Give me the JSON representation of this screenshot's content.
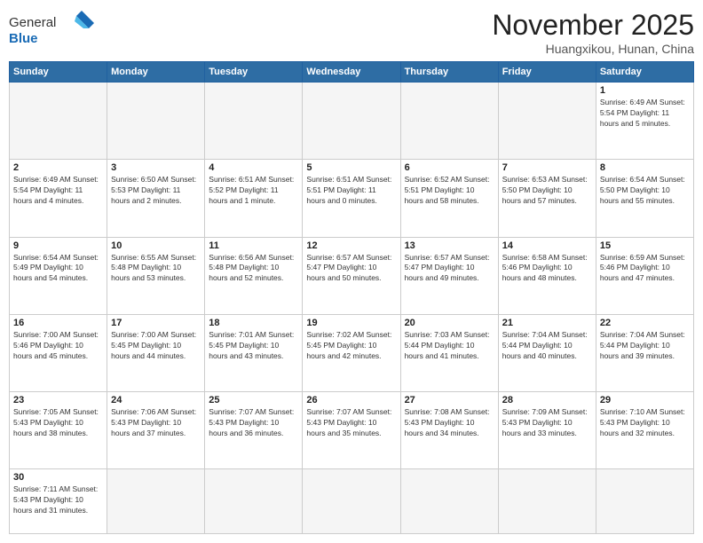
{
  "header": {
    "logo_general": "General",
    "logo_blue": "Blue",
    "month_title": "November 2025",
    "location": "Huangxikou, Hunan, China"
  },
  "days_of_week": [
    "Sunday",
    "Monday",
    "Tuesday",
    "Wednesday",
    "Thursday",
    "Friday",
    "Saturday"
  ],
  "weeks": [
    [
      {
        "day": "",
        "info": "",
        "empty": true
      },
      {
        "day": "",
        "info": "",
        "empty": true
      },
      {
        "day": "",
        "info": "",
        "empty": true
      },
      {
        "day": "",
        "info": "",
        "empty": true
      },
      {
        "day": "",
        "info": "",
        "empty": true
      },
      {
        "day": "",
        "info": "",
        "empty": true
      },
      {
        "day": "1",
        "info": "Sunrise: 6:49 AM\nSunset: 5:54 PM\nDaylight: 11 hours\nand 5 minutes."
      }
    ],
    [
      {
        "day": "2",
        "info": "Sunrise: 6:49 AM\nSunset: 5:54 PM\nDaylight: 11 hours\nand 4 minutes."
      },
      {
        "day": "3",
        "info": "Sunrise: 6:50 AM\nSunset: 5:53 PM\nDaylight: 11 hours\nand 2 minutes."
      },
      {
        "day": "4",
        "info": "Sunrise: 6:51 AM\nSunset: 5:52 PM\nDaylight: 11 hours\nand 1 minute."
      },
      {
        "day": "5",
        "info": "Sunrise: 6:51 AM\nSunset: 5:51 PM\nDaylight: 11 hours\nand 0 minutes."
      },
      {
        "day": "6",
        "info": "Sunrise: 6:52 AM\nSunset: 5:51 PM\nDaylight: 10 hours\nand 58 minutes."
      },
      {
        "day": "7",
        "info": "Sunrise: 6:53 AM\nSunset: 5:50 PM\nDaylight: 10 hours\nand 57 minutes."
      },
      {
        "day": "8",
        "info": "Sunrise: 6:54 AM\nSunset: 5:50 PM\nDaylight: 10 hours\nand 55 minutes."
      }
    ],
    [
      {
        "day": "9",
        "info": "Sunrise: 6:54 AM\nSunset: 5:49 PM\nDaylight: 10 hours\nand 54 minutes."
      },
      {
        "day": "10",
        "info": "Sunrise: 6:55 AM\nSunset: 5:48 PM\nDaylight: 10 hours\nand 53 minutes."
      },
      {
        "day": "11",
        "info": "Sunrise: 6:56 AM\nSunset: 5:48 PM\nDaylight: 10 hours\nand 52 minutes."
      },
      {
        "day": "12",
        "info": "Sunrise: 6:57 AM\nSunset: 5:47 PM\nDaylight: 10 hours\nand 50 minutes."
      },
      {
        "day": "13",
        "info": "Sunrise: 6:57 AM\nSunset: 5:47 PM\nDaylight: 10 hours\nand 49 minutes."
      },
      {
        "day": "14",
        "info": "Sunrise: 6:58 AM\nSunset: 5:46 PM\nDaylight: 10 hours\nand 48 minutes."
      },
      {
        "day": "15",
        "info": "Sunrise: 6:59 AM\nSunset: 5:46 PM\nDaylight: 10 hours\nand 47 minutes."
      }
    ],
    [
      {
        "day": "16",
        "info": "Sunrise: 7:00 AM\nSunset: 5:46 PM\nDaylight: 10 hours\nand 45 minutes."
      },
      {
        "day": "17",
        "info": "Sunrise: 7:00 AM\nSunset: 5:45 PM\nDaylight: 10 hours\nand 44 minutes."
      },
      {
        "day": "18",
        "info": "Sunrise: 7:01 AM\nSunset: 5:45 PM\nDaylight: 10 hours\nand 43 minutes."
      },
      {
        "day": "19",
        "info": "Sunrise: 7:02 AM\nSunset: 5:45 PM\nDaylight: 10 hours\nand 42 minutes."
      },
      {
        "day": "20",
        "info": "Sunrise: 7:03 AM\nSunset: 5:44 PM\nDaylight: 10 hours\nand 41 minutes."
      },
      {
        "day": "21",
        "info": "Sunrise: 7:04 AM\nSunset: 5:44 PM\nDaylight: 10 hours\nand 40 minutes."
      },
      {
        "day": "22",
        "info": "Sunrise: 7:04 AM\nSunset: 5:44 PM\nDaylight: 10 hours\nand 39 minutes."
      }
    ],
    [
      {
        "day": "23",
        "info": "Sunrise: 7:05 AM\nSunset: 5:43 PM\nDaylight: 10 hours\nand 38 minutes."
      },
      {
        "day": "24",
        "info": "Sunrise: 7:06 AM\nSunset: 5:43 PM\nDaylight: 10 hours\nand 37 minutes."
      },
      {
        "day": "25",
        "info": "Sunrise: 7:07 AM\nSunset: 5:43 PM\nDaylight: 10 hours\nand 36 minutes."
      },
      {
        "day": "26",
        "info": "Sunrise: 7:07 AM\nSunset: 5:43 PM\nDaylight: 10 hours\nand 35 minutes."
      },
      {
        "day": "27",
        "info": "Sunrise: 7:08 AM\nSunset: 5:43 PM\nDaylight: 10 hours\nand 34 minutes."
      },
      {
        "day": "28",
        "info": "Sunrise: 7:09 AM\nSunset: 5:43 PM\nDaylight: 10 hours\nand 33 minutes."
      },
      {
        "day": "29",
        "info": "Sunrise: 7:10 AM\nSunset: 5:43 PM\nDaylight: 10 hours\nand 32 minutes."
      }
    ],
    [
      {
        "day": "30",
        "info": "Sunrise: 7:11 AM\nSunset: 5:43 PM\nDaylight: 10 hours\nand 31 minutes.",
        "last": true
      },
      {
        "day": "",
        "info": "",
        "empty": true,
        "last": true
      },
      {
        "day": "",
        "info": "",
        "empty": true,
        "last": true
      },
      {
        "day": "",
        "info": "",
        "empty": true,
        "last": true
      },
      {
        "day": "",
        "info": "",
        "empty": true,
        "last": true
      },
      {
        "day": "",
        "info": "",
        "empty": true,
        "last": true
      },
      {
        "day": "",
        "info": "",
        "empty": true,
        "last": true
      }
    ]
  ]
}
